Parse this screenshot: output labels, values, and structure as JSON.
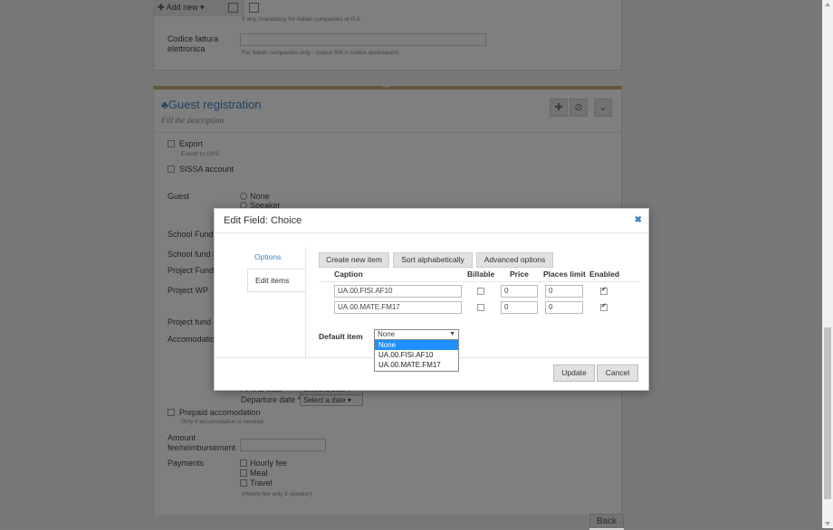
{
  "toolbar": {
    "add_new": "Add new",
    "caret": "▾"
  },
  "panel1": {
    "hint_top": "If any, mandatory for Italian companies or P.A.",
    "codice_label_1": "Codice fattura",
    "codice_label_2": "elettronica",
    "codice_hint": "For Italian companies only - codice IPA o codice destinatario"
  },
  "gripper": "•••",
  "guest": {
    "title": "Guest registration",
    "description": "Fill the description",
    "icons": {
      "add": "plus-icon",
      "disable": "ban-icon",
      "collapse": "chevron-down-icon"
    },
    "export_label": "Export",
    "export_hint": "Export to GRS",
    "sissa_label": "SISSA account",
    "guest_label": "Guest",
    "guest_opt_none": "None",
    "guest_opt_speaker": "Speaker",
    "school_fund": "School Fund",
    "school_fund_b": "School fund b",
    "project_fund": "Project Fund",
    "project_wp": "Project WP",
    "project_fund_b": "Project fund b",
    "accomodation": "Accomodation",
    "arrival_date": "Arrival date",
    "departure_date": "Departure date *",
    "select_date": "Select a date",
    "prepaid_label": "Prepaid accomodation",
    "prepaid_hint": "Only if accomodation is needed",
    "amount_label_1": "Amount",
    "amount_label_2": "fee/reimbursement",
    "payments_label": "Payments",
    "payment_opts": [
      "Hourly fee",
      "Meal",
      "Travel"
    ],
    "payments_hint": "(Hourly fee only if speaker)",
    "back": "Back"
  },
  "modal": {
    "title": "Edit Field: Choice",
    "close": "✖",
    "tabs": {
      "options": "Options",
      "edit_items": "Edit items"
    },
    "buttons": {
      "create": "Create new item",
      "sort": "Sort alphabetically",
      "advanced": "Advanced options"
    },
    "columns": {
      "caption": "Caption",
      "billable": "Billable",
      "price": "Price",
      "places": "Places limit",
      "enabled": "Enabled"
    },
    "items": [
      {
        "caption": "UA.00.FISI.AF10",
        "billable": false,
        "price": "0",
        "places": "0",
        "enabled": true
      },
      {
        "caption": "UA.00.MATE.FM17",
        "billable": false,
        "price": "0",
        "places": "0",
        "enabled": true
      }
    ],
    "default_label": "Default item",
    "default_value": "None",
    "dropdown_arrow": "▼",
    "dropdown_options": [
      "None",
      "UA.00.FISI.AF10",
      "UA.00.MATE.FM17"
    ],
    "footer": {
      "update": "Update",
      "cancel": "Cancel"
    }
  }
}
